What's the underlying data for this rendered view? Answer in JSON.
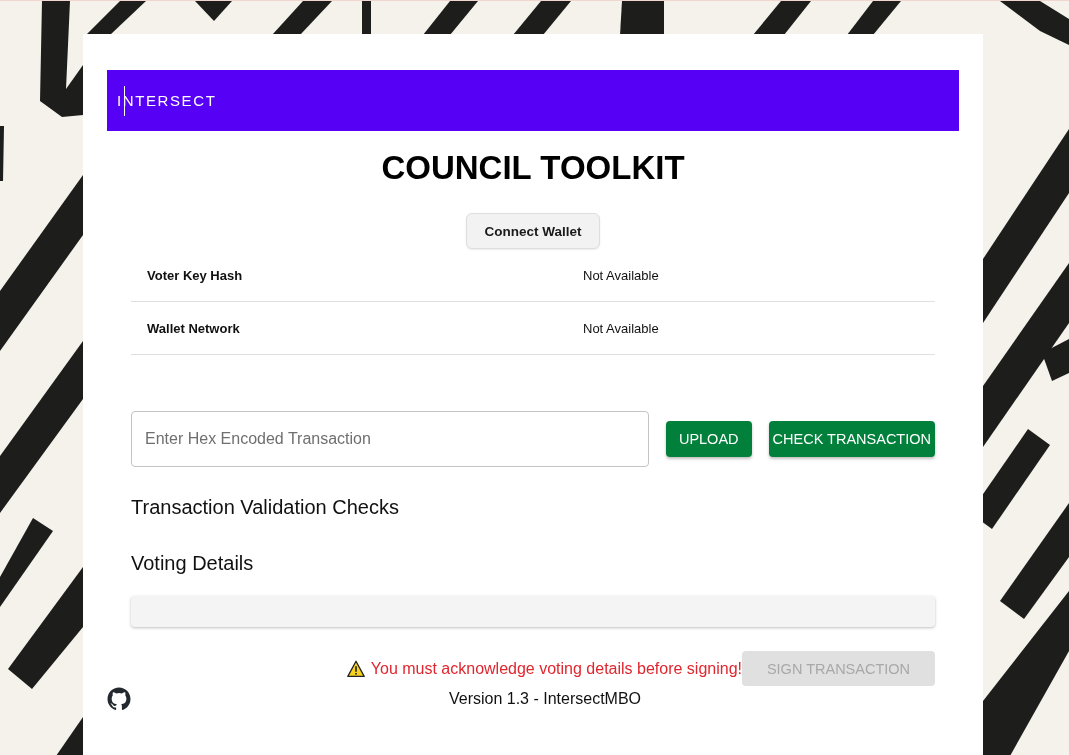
{
  "header": {
    "logo": "INTERSECT"
  },
  "title": "COUNCIL TOOLKIT",
  "connect_button": {
    "label": "Connect Wallet"
  },
  "info_rows": [
    {
      "label": "Voter Key Hash",
      "value": "Not Available"
    },
    {
      "label": "Wallet Network",
      "value": "Not Available"
    }
  ],
  "transaction_input": {
    "placeholder": "Enter Hex Encoded Transaction"
  },
  "actions": [
    {
      "label": "UPLOAD"
    },
    {
      "label": "CHECK TRANSACTION"
    }
  ],
  "sections": [
    {
      "title": "Transaction Validation Checks"
    },
    {
      "title": "Voting Details"
    }
  ],
  "warning": {
    "text": "You must acknowledge voting details before signing!"
  },
  "sign_button": {
    "label": "SIGN TRANSACTION",
    "disabled": true
  },
  "footer": {
    "version": "Version 1.3 - IntersectMBO"
  }
}
